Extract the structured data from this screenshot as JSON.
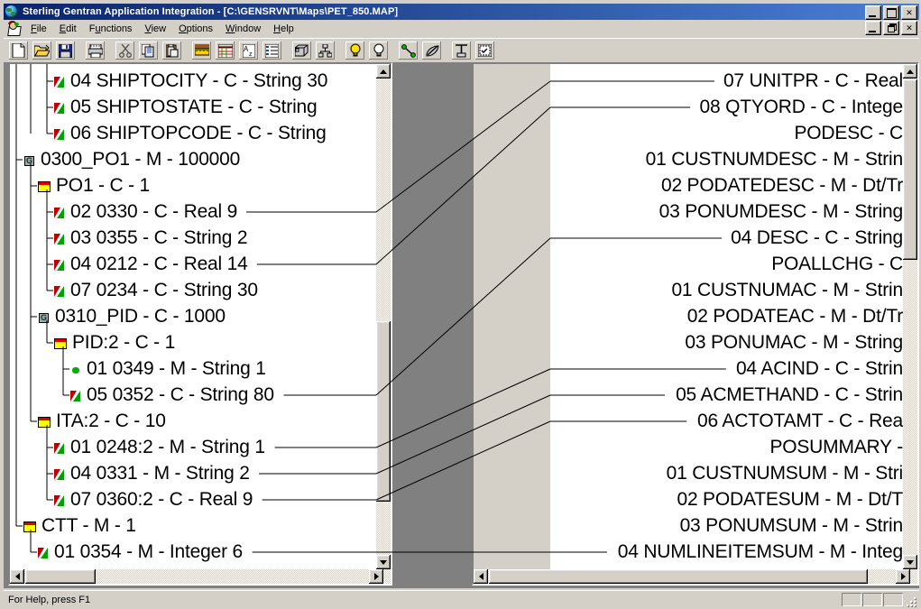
{
  "window": {
    "title": "Sterling Gentran Application Integration - [C:\\GENSRVNT\\Maps\\PET_850.MAP]",
    "icon": "globe-icon",
    "controls": {
      "minimize": "_",
      "maximize": "□",
      "close": "✕",
      "restore": "❐"
    }
  },
  "menubar": {
    "icon": "mdi-document-icon",
    "items": [
      {
        "label": "File",
        "accel": "F"
      },
      {
        "label": "Edit",
        "accel": "E"
      },
      {
        "label": "Functions",
        "accel": "u"
      },
      {
        "label": "View",
        "accel": "V"
      },
      {
        "label": "Options",
        "accel": "O"
      },
      {
        "label": "Window",
        "accel": "W"
      },
      {
        "label": "Help",
        "accel": "H"
      }
    ]
  },
  "toolbar": {
    "buttons": [
      {
        "name": "new-icon",
        "tip": "New"
      },
      {
        "name": "open-folder-icon",
        "tip": "Open"
      },
      {
        "name": "save-disk-icon",
        "tip": "Save"
      },
      {
        "separator": true
      },
      {
        "name": "print-icon",
        "tip": "Print"
      },
      {
        "separator": true
      },
      {
        "name": "cut-scissors-icon",
        "tip": "Cut"
      },
      {
        "name": "copy-icon",
        "tip": "Copy"
      },
      {
        "name": "paste-clipboard-icon",
        "tip": "Paste"
      },
      {
        "separator": true
      },
      {
        "name": "ruler-icon",
        "tip": "Ruler"
      },
      {
        "name": "grid-icon",
        "tip": "Grid"
      },
      {
        "name": "sort-az-icon",
        "tip": "Sort"
      },
      {
        "name": "list-details-icon",
        "tip": "Details"
      },
      {
        "separator": true
      },
      {
        "name": "database-icon",
        "tip": "Database"
      },
      {
        "name": "hierarchy-icon",
        "tip": "Hierarchy"
      },
      {
        "separator": true
      },
      {
        "name": "lightbulb-on-icon",
        "tip": "Show Links"
      },
      {
        "name": "lightbulb-off-icon",
        "tip": "Hide Links"
      },
      {
        "separator": true
      },
      {
        "name": "link-nodes-icon",
        "tip": "Link"
      },
      {
        "name": "unlink-icon",
        "tip": "Unlink"
      },
      {
        "separator": true
      },
      {
        "name": "compile-icon",
        "tip": "Compile"
      },
      {
        "name": "validate-icon",
        "tip": "Validate"
      }
    ]
  },
  "left_pane": {
    "name": "source-map-tree",
    "rows": [
      {
        "indent": 3,
        "icon": "flag",
        "label": "04 SHIPTOCITY - C - String 30",
        "link": false
      },
      {
        "indent": 3,
        "icon": "flag",
        "label": "05 SHIPTOSTATE - C - String",
        "link": false
      },
      {
        "indent": 3,
        "icon": "flag",
        "label": "06 SHIPTOPCODE - C - String",
        "link": false
      },
      {
        "indent": 1,
        "icon": "group",
        "label": "0300_PO1 - M -  100000",
        "link": false
      },
      {
        "indent": 2,
        "icon": "rec",
        "label": "PO1 - C -  1",
        "link": false
      },
      {
        "indent": 3,
        "icon": "flag",
        "label": "02 0330 - C - Real 9",
        "link": true
      },
      {
        "indent": 3,
        "icon": "flag",
        "label": "03 0355 - C - String 2",
        "link": false
      },
      {
        "indent": 3,
        "icon": "flag",
        "label": "04 0212 - C - Real 14",
        "link": true
      },
      {
        "indent": 3,
        "icon": "flag",
        "label": "07 0234 - C - String 30",
        "link": false
      },
      {
        "indent": 2,
        "icon": "group",
        "label": "0310_PID - C -  1000",
        "link": false
      },
      {
        "indent": 3,
        "icon": "rec",
        "label": "PID:2 - C -  1",
        "link": false
      },
      {
        "indent": 4,
        "icon": "dot",
        "label": "01 0349 - M - String 1",
        "link": false
      },
      {
        "indent": 4,
        "icon": "flag",
        "label": "05 0352 - C - String 80",
        "link": true
      },
      {
        "indent": 2,
        "icon": "rec",
        "label": "ITA:2 - C -  10",
        "link": false
      },
      {
        "indent": 3,
        "icon": "flag",
        "label": "01 0248:2 - M - String 1",
        "link": true
      },
      {
        "indent": 3,
        "icon": "flag",
        "label": "04 0331 - M - String 2",
        "link": true
      },
      {
        "indent": 3,
        "icon": "flag",
        "label": "07 0360:2 - C - Real 9",
        "link": true
      },
      {
        "indent": 1,
        "icon": "rec",
        "label": "CTT - M -  1",
        "link": false
      },
      {
        "indent": 2,
        "icon": "flag",
        "label": "01 0354 - M - Integer 6",
        "link": true
      }
    ],
    "vscroll": {
      "position": "middle"
    },
    "hscroll": {
      "position": "left"
    }
  },
  "right_pane": {
    "name": "target-map-tree",
    "rows": [
      {
        "label": "07 UNITPR - C - Real",
        "link": true
      },
      {
        "label": "08 QTYORD - C - Intege",
        "link": true
      },
      {
        "label": "PODESC - C",
        "link": false
      },
      {
        "label": "01 CUSTNUMDESC - M - Strin",
        "link": false
      },
      {
        "label": "02 PODATEDESC - M - Dt/Tr",
        "link": false
      },
      {
        "label": "03 PONUMDESC - M - String",
        "link": false
      },
      {
        "label": "04 DESC - C - String",
        "link": true
      },
      {
        "label": "POALLCHG - C",
        "link": false
      },
      {
        "label": "01 CUSTNUMAC - M - Strin",
        "link": false
      },
      {
        "label": "02 PODATEAC - M - Dt/Tr",
        "link": false
      },
      {
        "label": "03 PONUMAC - M - String",
        "link": false
      },
      {
        "label": "04 ACIND - C - Strin",
        "link": true
      },
      {
        "label": "05 ACMETHAND - C - Strin",
        "link": true
      },
      {
        "label": "06 ACTOTAMT - C - Rea",
        "link": true
      },
      {
        "label": "POSUMMARY -",
        "link": false
      },
      {
        "label": "01 CUSTNUMSUM - M - Stri",
        "link": false
      },
      {
        "label": "02 PODATESUM - M - Dt/T",
        "link": false
      },
      {
        "label": "03 PONUMSUM - M - Strin",
        "link": false
      },
      {
        "label": "04 NUMLINEITEMSUM - M - Integ",
        "link": true
      }
    ],
    "vscroll": {
      "position": "top"
    },
    "hscroll": {
      "position": "right"
    }
  },
  "statusbar": {
    "text": "For Help, press F1",
    "panes": [
      "",
      "",
      ""
    ]
  },
  "colors": {
    "titlebar_start": "#0a246a",
    "titlebar_end": "#4a7fd4",
    "face": "#d4d0c8",
    "tree_bg": "#ffffff",
    "icon_green": "#00a000",
    "icon_red": "#c00000",
    "icon_yellow": "#ffff00"
  }
}
